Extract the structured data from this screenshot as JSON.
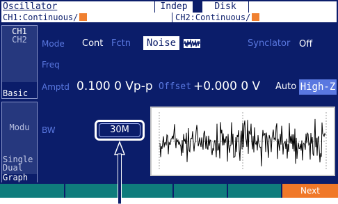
{
  "header": {
    "title": "Oscillator",
    "indep": "Indep",
    "disk": "Disk",
    "ch1_status": "CH1:Continuous/",
    "ch2_status": "CH2:Continuous/"
  },
  "left_tabs": {
    "ch1": "CH1",
    "ch2": "CH2",
    "basic": "Basic",
    "modu": "Modu",
    "single": "Single",
    "dual": "Dual",
    "graph": "Graph"
  },
  "params": {
    "mode_label": "Mode",
    "mode_value": "Cont",
    "fctn_label": "Fctn",
    "fctn_value": "Noise",
    "fctn_icon": "noise-waveform-icon",
    "synclator_label": "Synclator",
    "synclator_value": "Off",
    "freq_label": "Freq",
    "amptd_label": "Amptd",
    "amptd_value": "0.100 0 Vp-p",
    "offset_label": "Offset",
    "offset_value": "+0.000 0 V",
    "auto_label": "Auto",
    "load_value": "High-Z",
    "bw_label": "BW",
    "bw_value": "30M"
  },
  "softkeys": [
    "",
    "",
    "",
    "",
    "",
    "Next"
  ],
  "colors": {
    "background": "#0b1d6a",
    "label": "#5a78e0",
    "softkey": "#0f7c7c",
    "softkey_next": "#f07828",
    "channel_swatch": "#f08030",
    "callout_arrow": "#0b1d6a"
  }
}
